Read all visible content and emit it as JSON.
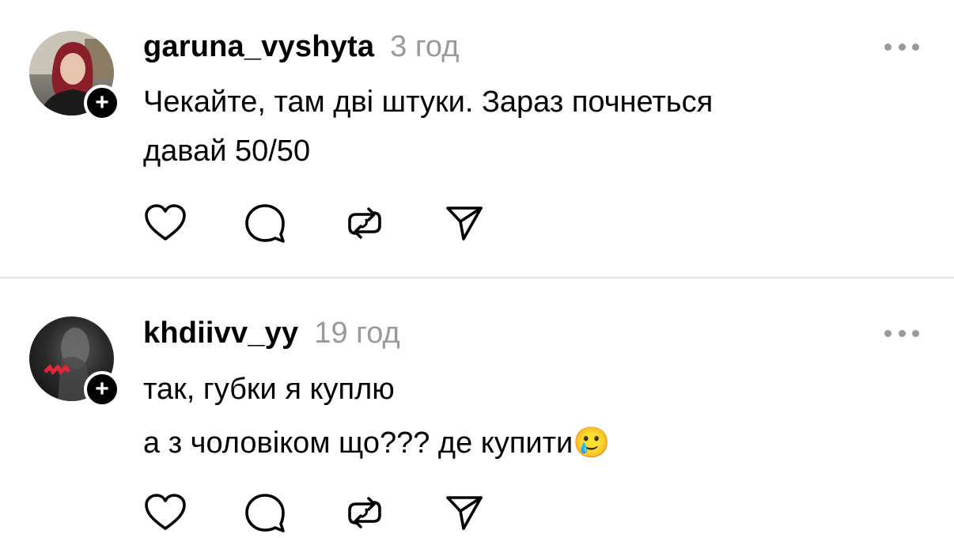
{
  "posts": [
    {
      "username": "garuna_vyshyta",
      "time": "3 год",
      "lines": [
        "Чекайте, там дві штуки. Зараз почнеться",
        "давай 50/50"
      ],
      "follow_symbol": "+"
    },
    {
      "username": "khdiivv_yy",
      "time": "19 год",
      "lines": [
        "так, губки я куплю",
        "а з чоловіком що??? де купити🥲"
      ],
      "follow_symbol": "+"
    }
  ],
  "icons": {
    "like": "heart-icon",
    "reply": "comment-icon",
    "repost": "repost-icon",
    "share": "send-icon",
    "more": "more-icon",
    "follow": "plus-icon"
  },
  "colors": {
    "text": "#000000",
    "muted": "#9a9a9a",
    "divider": "#e2e2e2",
    "badge": "#000000"
  }
}
